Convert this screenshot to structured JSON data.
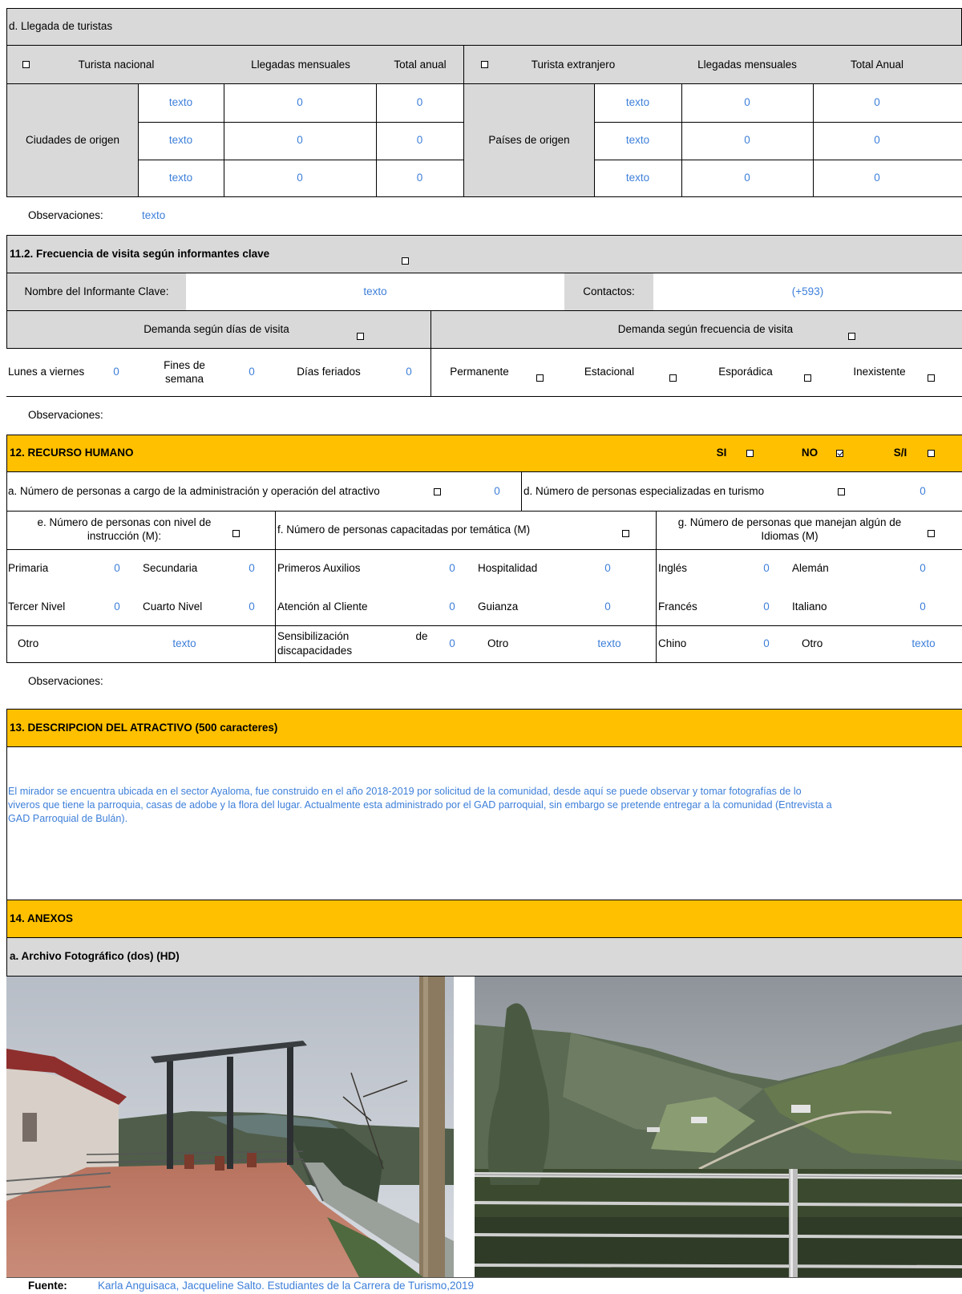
{
  "tourists": {
    "title": "d. Llegada de turistas",
    "national_label": "Turista nacional",
    "monthly_label": "Llegadas mensuales",
    "total_label": "Total anual",
    "foreign_label": "Turista extranjero",
    "monthly_label2": "Llegadas mensuales",
    "total_label2": "Total Anual",
    "cities_label": "Ciudades de origen",
    "countries_label": "Países de origen",
    "rows": [
      {
        "city": "texto",
        "city_monthly": "0",
        "city_total": "0",
        "country": "texto",
        "country_monthly": "0",
        "country_total": "0"
      },
      {
        "city": "texto",
        "city_monthly": "0",
        "city_total": "0",
        "country": "texto",
        "country_monthly": "0",
        "country_total": "0"
      },
      {
        "city": "texto",
        "city_monthly": "0",
        "city_total": "0",
        "country": "texto",
        "country_monthly": "0",
        "country_total": "0"
      }
    ],
    "obs_label": "Observaciones:",
    "obs_value": "texto"
  },
  "frequency": {
    "title": "11.2. Frecuencia de visita según informantes clave",
    "informant_label": "Nombre del Informante Clave:",
    "informant_value": "texto",
    "contacts_label": "Contactos:",
    "contacts_value": "(+593)",
    "days_header": "Demanda según  días de visita",
    "freq_header": "Demanda según frecuencia de visita",
    "weekdays_label": "Lunes a viernes",
    "weekdays_value": "0",
    "weekends_label": "Fines de semana",
    "weekends_value": "0",
    "holidays_label": "Días feriados",
    "holidays_value": "0",
    "permanent_label": "Permanente",
    "seasonal_label": "Estacional",
    "sporadic_label": "Esporádica",
    "nonexistent_label": "Inexistente",
    "obs_label": "Observaciones:"
  },
  "hr": {
    "title": "12. RECURSO HUMANO",
    "si_label": "SI",
    "no_label": "NO",
    "si_checked": false,
    "no_checked": true,
    "sni_label": "S/I",
    "admin_label": "a. Número de personas a cargo de la administración y operación del atractivo",
    "admin_value": "0",
    "tourism_label": "d. Número de personas especializadas en turismo",
    "tourism_value": "0",
    "instr_label": "e. Número de personas con nivel de instrucción (M):",
    "trained_label": "f. Número de personas capacitadas por temática (M)",
    "lang_label": "g. Número de personas que manejan algún de Idiomas (M)",
    "primaria": "Primaria",
    "primaria_v": "0",
    "secundaria": "Secundaria",
    "secundaria_v": "0",
    "tercer": "Tercer Nivel",
    "tercer_v": "0",
    "cuarto": "Cuarto Nivel",
    "cuarto_v": "0",
    "otro1": "Otro",
    "otro1_v": "texto",
    "aux": "Primeros Auxilios",
    "aux_v": "0",
    "hosp": "Hospitalidad",
    "hosp_v": "0",
    "aten": "Atención al Cliente",
    "aten_v": "0",
    "guia": "Guianza",
    "guia_v": "0",
    "sens1": "Sensibilización",
    "sens_de": "de",
    "sens2": "discapacidades",
    "sens_v": "0",
    "otro2": "Otro",
    "otro2_v": "texto",
    "ingles": "Inglés",
    "ingles_v": "0",
    "aleman": "Alemán",
    "aleman_v": "0",
    "frances": "Francés",
    "frances_v": "0",
    "italiano": "Italiano",
    "italiano_v": "0",
    "chino": "Chino",
    "chino_v": "0",
    "otro3": "Otro",
    "otro3_v": "texto",
    "obs_label": "Observaciones:"
  },
  "description": {
    "title": "13. DESCRIPCION DEL ATRACTIVO (500 caracteres)",
    "line1": "El mirador se encuentra ubicada en el sector Ayaloma, fue construido en el año 2018-2019 por solicitud de la comunidad, desde aquí se puede observar y tomar fotografías de lo",
    "line2": "viveros que tiene la parroquia, casas de adobe y la flora del lugar. Actualmente esta administrado por el GAD parroquial, sin embargo se pretende entregar a la comunidad (Entrevista a",
    "line3": "GAD Parroquial de Bulán)."
  },
  "annex": {
    "title": "14. ANEXOS",
    "photo_title": "a. Archivo Fotográfico (dos) (HD)",
    "source_label": "Fuente:",
    "source_value": "Karla Anguisaca, Jacqueline Salto. Estudiantes de la Carrera de Turismo,2019"
  },
  "colors": {
    "gray": "#d9d9d9",
    "orange": "#ffc000",
    "value_blue": "#3d7fd9"
  }
}
